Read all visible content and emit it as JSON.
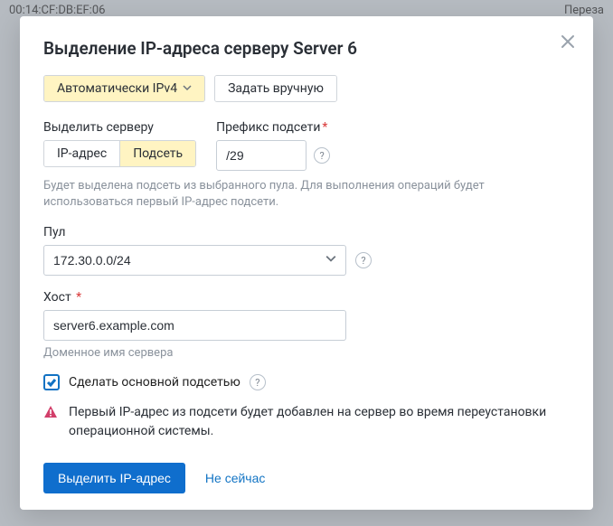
{
  "backdrop": {
    "mac": "00:14:CF:DB:EF:06",
    "right": "Переза"
  },
  "modal": {
    "title": "Выделение IP-адреса серверу Server 6",
    "mode": {
      "auto": "Автоматически IPv4",
      "manual": "Задать вручную"
    },
    "alloc": {
      "label": "Выделить серверу",
      "ip": "IP-адрес",
      "subnet": "Подсеть"
    },
    "prefix": {
      "label": "Префикс подсети",
      "value": "/29"
    },
    "hint1": "Будет выделена подсеть из выбранного пула. Для выполнения операций будет использоваться первый IP-адрес подсети.",
    "pool": {
      "label": "Пул",
      "value": "172.30.0.0/24"
    },
    "host": {
      "label": "Хост",
      "value": "server6.example.com",
      "hint": "Доменное имя сервера"
    },
    "primary": {
      "label": "Сделать основной подсетью"
    },
    "warning": "Первый IP-адрес из подсети будет добавлен на сервер во время переустановки операционной системы.",
    "footer": {
      "submit": "Выделить IP-адрес",
      "cancel": "Не сейчас"
    }
  }
}
